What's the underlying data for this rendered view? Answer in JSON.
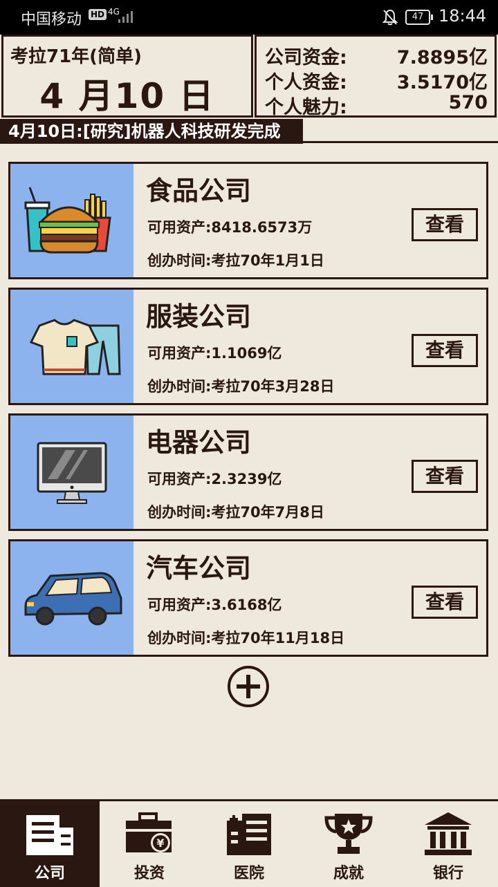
{
  "status_bar": {
    "carrier": "中国移动",
    "net_badge": "HD",
    "net_type": "4G",
    "battery": "47",
    "time": "18:44"
  },
  "header": {
    "era": "考拉71年(简单)",
    "date": "4 月10 日",
    "stats": [
      {
        "label": "公司资金:",
        "value": "7.8895亿"
      },
      {
        "label": "个人资金:",
        "value": "3.5170亿"
      },
      {
        "label": "个人魅力:",
        "value": "570"
      }
    ]
  },
  "news_ticker": "4月10日:[研究]机器人科技研发完成",
  "companies": [
    {
      "name": "食品公司",
      "assets": "可用资产:8418.6573万",
      "founded": "创办时间:考拉70年1月1日",
      "button": "查看",
      "icon": "burger-fries-icon"
    },
    {
      "name": "服装公司",
      "assets": "可用资产:1.1069亿",
      "founded": "创办时间:考拉70年3月28日",
      "button": "查看",
      "icon": "clothes-icon"
    },
    {
      "name": "电器公司",
      "assets": "可用资产:2.3239亿",
      "founded": "创办时间:考拉70年7月8日",
      "button": "查看",
      "icon": "monitor-icon"
    },
    {
      "name": "汽车公司",
      "assets": "可用资产:3.6168亿",
      "founded": "创办时间:考拉70年11月18日",
      "button": "查看",
      "icon": "car-icon"
    }
  ],
  "bottom_nav": [
    {
      "label": "公司",
      "active": true,
      "icon": "company-icon"
    },
    {
      "label": "投资",
      "active": false,
      "icon": "investment-briefcase-icon"
    },
    {
      "label": "医院",
      "active": false,
      "icon": "hospital-icon"
    },
    {
      "label": "成就",
      "active": false,
      "icon": "trophy-icon"
    },
    {
      "label": "银行",
      "active": false,
      "icon": "bank-icon"
    }
  ],
  "colors": {
    "background": "#efe9dd",
    "ink": "#2a1712",
    "card_image_bg": "#8db3ef"
  }
}
